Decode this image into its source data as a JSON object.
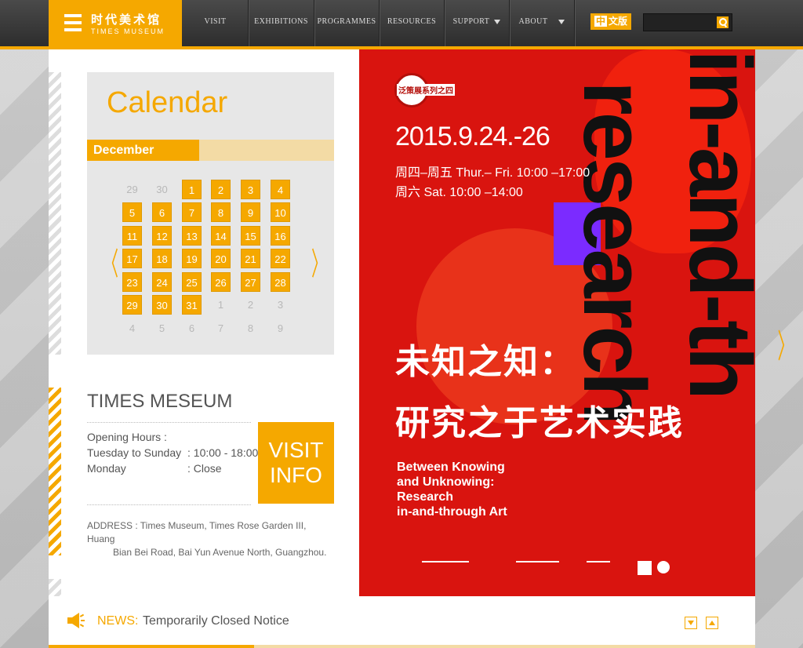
{
  "header": {
    "logo_cn": "时代美术馆",
    "logo_en": "TIMES MUSEUM",
    "nav": [
      {
        "label": "VISIT",
        "dropdown": false
      },
      {
        "label": "EXHIBITIONS",
        "dropdown": false
      },
      {
        "label": "PROGRAMMES",
        "dropdown": false
      },
      {
        "label": "RESOURCES",
        "dropdown": false
      },
      {
        "label": "SUPPORT",
        "dropdown": true
      },
      {
        "label": "ABOUT",
        "dropdown": true
      }
    ],
    "lang_zhong": "中",
    "lang_wen": "文版",
    "search_placeholder": "",
    "search_value": ""
  },
  "calendar": {
    "title": "Calendar",
    "month": "December",
    "days": [
      [
        "29",
        "30",
        "1",
        "2",
        "3",
        "4"
      ],
      [
        "5",
        "6",
        "7",
        "8",
        "9",
        "10"
      ],
      [
        "11",
        "12",
        "13",
        "14",
        "15",
        "16"
      ],
      [
        "17",
        "18",
        "19",
        "20",
        "21",
        "22"
      ],
      [
        "23",
        "24",
        "25",
        "26",
        "27",
        "28"
      ],
      [
        "29",
        "30",
        "31",
        "1",
        "2",
        "3"
      ],
      [
        "4",
        "5",
        "6",
        "7",
        "8",
        "9"
      ]
    ],
    "prev": "〈",
    "next": "〉"
  },
  "info": {
    "title": "TIMES MESEUM",
    "hours_label": "Opening Hours :",
    "rows": [
      {
        "day": "Tuesday to Sunday",
        "time": ": 10:00 - 18:00"
      },
      {
        "day": "Monday",
        "time": ": Close"
      }
    ],
    "visit_line1": "VISIT",
    "visit_line2": "INFO",
    "address_line1": "ADDRESS : Times Museum, Times Rose Garden III, Huang",
    "address_line2": "Bian Bei Road, Bai Yun Avenue North, Guangzhou."
  },
  "poster": {
    "badge": "泛策展系列之四",
    "date": "2015.9.24.-26",
    "time1": "周四–周五 Thur.– Fri. 10:00 –17:00",
    "time2": "周六 Sat. 10:00 –14:00",
    "cn1": "未知之知：",
    "cn2": "研究之于艺术实践",
    "en1": "Between Knowing",
    "en2": "and Unknowing:",
    "en3": "Research",
    "en4": "in-and-through Art",
    "vert1": "research",
    "vert2": "in-and-th"
  },
  "slider_next": "〉",
  "news": {
    "label": "NEWS:",
    "text": "Temporarily Closed Notice"
  },
  "colors": {
    "accent": "#f5a800",
    "poster_red": "#d9140f"
  }
}
